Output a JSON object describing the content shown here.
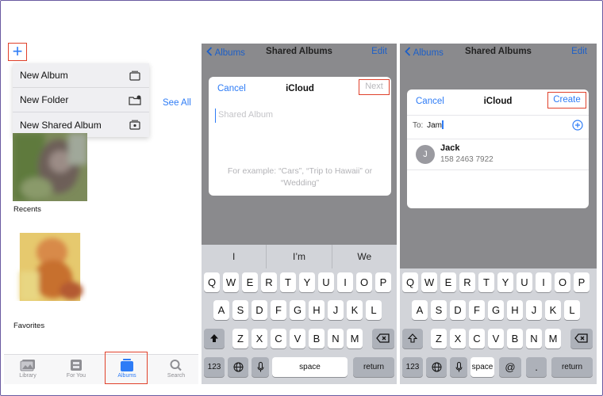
{
  "panel1": {
    "plus_label": "+",
    "menu": [
      {
        "label": "New Album",
        "icon": "album-stack-icon"
      },
      {
        "label": "New Folder",
        "icon": "folder-add-icon"
      },
      {
        "label": "New Shared Album",
        "icon": "shared-album-icon"
      }
    ],
    "see_all": "See All",
    "albums": [
      {
        "label": "Recents"
      },
      {
        "label": "Favorites"
      }
    ],
    "tabs": [
      {
        "label": "Library",
        "icon": "photo-library-icon"
      },
      {
        "label": "For You",
        "icon": "for-you-icon"
      },
      {
        "label": "Albums",
        "icon": "albums-icon",
        "active": true
      },
      {
        "label": "Search",
        "icon": "search-icon"
      }
    ]
  },
  "panel2": {
    "nav": {
      "back": "Albums",
      "title": "Shared Albums",
      "edit": "Edit"
    },
    "dialog": {
      "cancel": "Cancel",
      "title": "iCloud",
      "next": "Next",
      "placeholder": "Shared Album",
      "hint": "For example: “Cars”, “Trip to Hawaii” or “Wedding”"
    },
    "suggestions": [
      "I",
      "I’m",
      "We"
    ]
  },
  "panel3": {
    "nav": {
      "back": "Albums",
      "title": "Shared Albums",
      "edit": "Edit"
    },
    "dialog": {
      "cancel": "Cancel",
      "title": "iCloud",
      "create": "Create",
      "to_label": "To:",
      "to_value": "Jam",
      "contact": {
        "initial": "J",
        "name": "Jack",
        "phone": "158 2463 7922"
      }
    }
  },
  "keyboard": {
    "row1": [
      "Q",
      "W",
      "E",
      "R",
      "T",
      "Y",
      "U",
      "I",
      "O",
      "P"
    ],
    "row2": [
      "A",
      "S",
      "D",
      "F",
      "G",
      "H",
      "J",
      "K",
      "L"
    ],
    "row3": [
      "Z",
      "X",
      "C",
      "V",
      "B",
      "N",
      "M"
    ],
    "num_key": "123",
    "space": "space",
    "return": "return",
    "at": "@",
    "dot": "."
  },
  "colors": {
    "accent": "#2e7cf6",
    "highlight": "#e0412b",
    "screen_bg": "#8a8a8d",
    "keyboard_bg": "#d2d4d9"
  }
}
